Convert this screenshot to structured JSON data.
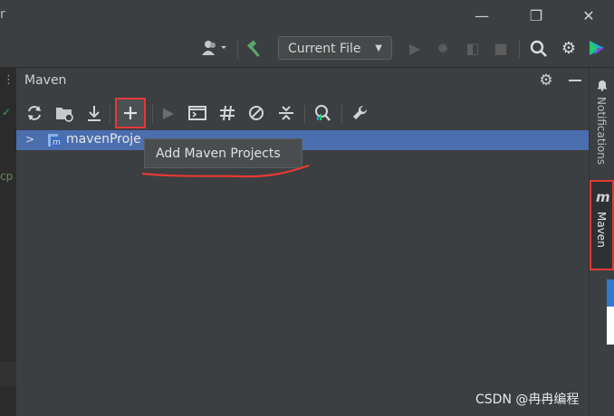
{
  "titlebar": {
    "partial_left_text": "r",
    "minimize_glyph": "—",
    "restore_glyph": "❐",
    "close_glyph": "✕"
  },
  "toolbar": {
    "run_config": "Current File",
    "icons": [
      "user-icon",
      "build-hammer-icon",
      "run-icon",
      "debug-icon",
      "coverage-icon",
      "stop-icon",
      "search-icon",
      "gear-icon",
      "toolbox-icon"
    ]
  },
  "left_gutter": {
    "dots": "⋮",
    "text_fragment": "cp",
    "check": "✓"
  },
  "maven_panel": {
    "title": "Maven",
    "header_icons": [
      "gear-icon",
      "minimize-icon"
    ],
    "tools": [
      "reload-icon",
      "generate-sources-icon",
      "download-icon",
      "add-icon",
      "run-icon",
      "execute-goal-icon",
      "toggle-offline-icon",
      "skip-tests-icon",
      "collapse-all-icon",
      "analyze-dependencies-icon",
      "settings-wrench-icon"
    ],
    "tree": [
      {
        "label": "mavenProje",
        "expanded": false
      }
    ],
    "tooltip": "Add Maven Projects"
  },
  "right_sidebar": {
    "notifications_label": "Notifications",
    "maven_label": "Maven",
    "maven_logo_letter": "m"
  },
  "watermark": "CSDN @冉冉编程",
  "colors": {
    "highlight_box": "#e53935",
    "selection": "#4b6eaf",
    "underline": "#e53935"
  }
}
